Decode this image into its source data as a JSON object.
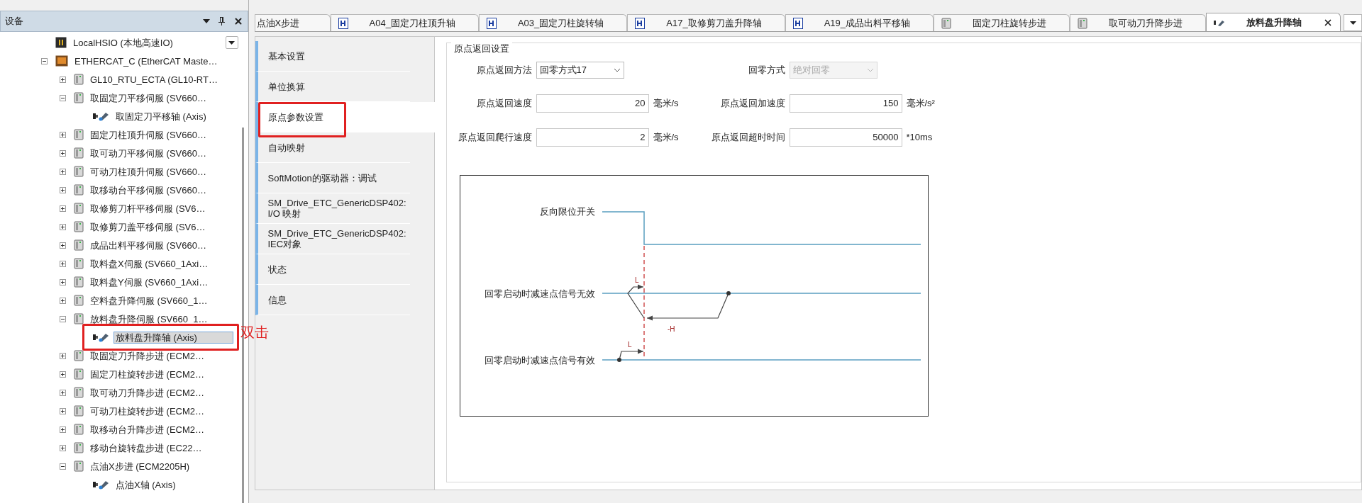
{
  "devices_panel": {
    "title": "设备",
    "tree": [
      {
        "label": "LocalHSIO (本地高速IO)",
        "kind": "io"
      },
      {
        "label": "ETHERCAT_C (EtherCAT Maste…",
        "kind": "ethercat",
        "expanded": true,
        "children": [
          {
            "label": "GL10_RTU_ECTA (GL10-RT…",
            "kind": "module",
            "expanded": false,
            "selected": false
          },
          {
            "label": "取固定刀平移伺服 (SV660…",
            "kind": "module",
            "expanded": true,
            "selected": false,
            "children": [
              {
                "label": "取固定刀平移轴 (Axis)",
                "kind": "axis",
                "selected": false,
                "highlighted": false
              }
            ]
          },
          {
            "label": "固定刀柱顶升伺服 (SV660…",
            "kind": "module",
            "expanded": false,
            "selected": false
          },
          {
            "label": "取可动刀平移伺服 (SV660…",
            "kind": "module",
            "expanded": false,
            "selected": false
          },
          {
            "label": "可动刀柱顶升伺服 (SV660…",
            "kind": "module",
            "expanded": false,
            "selected": false
          },
          {
            "label": "取移动台平移伺服 (SV660…",
            "kind": "module",
            "expanded": false,
            "selected": false
          },
          {
            "label": "取修剪刀杆平移伺服 (SV6…",
            "kind": "module",
            "expanded": false,
            "selected": false
          },
          {
            "label": "取修剪刀盖平移伺服 (SV6…",
            "kind": "module",
            "expanded": false,
            "selected": false
          },
          {
            "label": "成品出料平移伺服 (SV660…",
            "kind": "module",
            "expanded": false,
            "selected": false
          },
          {
            "label": "取料盘X伺服 (SV660_1Axi…",
            "kind": "module",
            "expanded": false,
            "selected": false
          },
          {
            "label": "取料盘Y伺服 (SV660_1Axi…",
            "kind": "module",
            "expanded": false,
            "selected": false
          },
          {
            "label": "空料盘升降伺服 (SV660_1…",
            "kind": "module",
            "expanded": false,
            "selected": false
          },
          {
            "label": "放料盘升降伺服 (SV660_1…",
            "kind": "module",
            "expanded": true,
            "selected": false,
            "children": [
              {
                "label": "放料盘升降轴 (Axis)",
                "kind": "axis",
                "selected": true,
                "highlighted": true
              }
            ]
          },
          {
            "label": "取固定刀升降步进 (ECM2…",
            "kind": "module",
            "expanded": false,
            "selected": false
          },
          {
            "label": "固定刀柱旋转步进 (ECM2…",
            "kind": "module",
            "expanded": false,
            "selected": false
          },
          {
            "label": "取可动刀升降步进 (ECM2…",
            "kind": "module",
            "expanded": false,
            "selected": false
          },
          {
            "label": "可动刀柱旋转步进 (ECM2…",
            "kind": "module",
            "expanded": false,
            "selected": false
          },
          {
            "label": "取移动台升降步进 (ECM2…",
            "kind": "module",
            "expanded": false,
            "selected": false
          },
          {
            "label": "移动台旋转盘步进 (EC22…",
            "kind": "module",
            "expanded": false,
            "selected": false
          },
          {
            "label": "点油X步进 (ECM2205H)",
            "kind": "module",
            "expanded": true,
            "selected": false,
            "children": [
              {
                "label": "点油X轴 (Axis)",
                "kind": "axis",
                "selected": false,
                "highlighted": false
              }
            ]
          }
        ]
      }
    ],
    "annotation": "双击"
  },
  "editor_tabs": [
    {
      "label": "点油X步进",
      "kind": "cut",
      "selected": false
    },
    {
      "label": "A04_固定刀柱顶升轴",
      "kind": "axis-file",
      "selected": false
    },
    {
      "label": "A03_固定刀柱旋转轴",
      "kind": "axis-file",
      "selected": false
    },
    {
      "label": "A17_取修剪刀盖升降轴",
      "kind": "axis-file",
      "selected": false
    },
    {
      "label": "A19_成品出料平移轴",
      "kind": "axis-file",
      "selected": false
    },
    {
      "label": "固定刀柱旋转步进",
      "kind": "module",
      "selected": false
    },
    {
      "label": "取可动刀升降步进",
      "kind": "module",
      "selected": false
    },
    {
      "label": "放料盘升降轴",
      "kind": "axis",
      "selected": true
    }
  ],
  "settings_nav": [
    {
      "label": "基本设置",
      "selected": false,
      "highlighted": false
    },
    {
      "label": "单位换算",
      "selected": false,
      "highlighted": false
    },
    {
      "label": "原点参数设置",
      "selected": true,
      "highlighted": true
    },
    {
      "label": "自动映射",
      "selected": false,
      "highlighted": false
    },
    {
      "label": "SoftMotion的驱动器：调试",
      "selected": false,
      "highlighted": false
    },
    {
      "label": "SM_Drive_ETC_GenericDSP402: I/O 映射",
      "selected": false,
      "highlighted": false
    },
    {
      "label": "SM_Drive_ETC_GenericDSP402: IEC对象",
      "selected": false,
      "highlighted": false
    },
    {
      "label": "状态",
      "selected": false,
      "highlighted": false
    },
    {
      "label": "信息",
      "selected": false,
      "highlighted": false
    }
  ],
  "homing": {
    "title": "原点返回设置",
    "rows": [
      [
        {
          "label": "原点返回方法",
          "kind": "select",
          "value": "回零方式17",
          "disabled": false
        },
        {
          "label": "回零方式",
          "kind": "select",
          "value": "绝对回零",
          "disabled": true
        }
      ],
      [
        {
          "label": "原点返回速度",
          "kind": "number",
          "value": "20",
          "unit": "毫米/s"
        },
        {
          "label": "原点返回加速度",
          "kind": "number",
          "value": "150",
          "unit": "毫米/s²"
        }
      ],
      [
        {
          "label": "原点返回爬行速度",
          "kind": "number",
          "value": "2",
          "unit": "毫米/s"
        },
        {
          "label": "原点返回超时时间",
          "kind": "number",
          "value": "50000",
          "unit": "*10ms"
        }
      ]
    ],
    "diagram": {
      "signals": [
        "反向限位开关",
        "回零启动时减速点信号无效",
        "回零启动时减速点信号有效"
      ],
      "marks": [
        "L",
        "-H",
        "L"
      ]
    }
  }
}
